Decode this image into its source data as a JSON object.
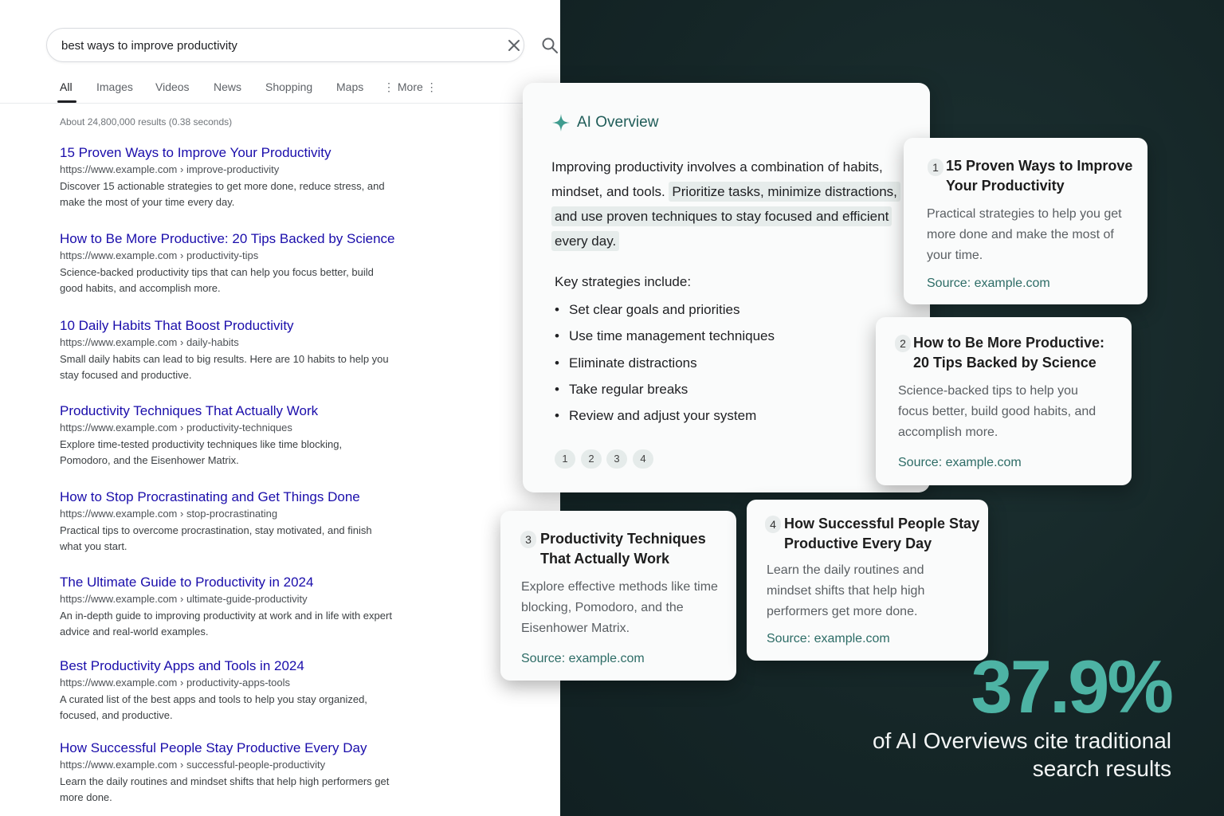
{
  "search": {
    "query": "best ways to improve productivity"
  },
  "tabs": [
    "All",
    "Images",
    "Videos",
    "News",
    "Shopping",
    "Maps",
    "⋮ More ⋮"
  ],
  "result_stats": "About 24,800,000 results (0.38 seconds)",
  "results": [
    {
      "title": "15 Proven Ways to Improve Your Productivity",
      "url": "https://www.example.com › improve-productivity",
      "snippet": "Discover 15 actionable strategies to get more done, reduce stress, and make the most of your time every day."
    },
    {
      "title": "How to Be More Productive: 20 Tips Backed by Science",
      "url": "https://www.example.com › productivity-tips",
      "snippet": "Science-backed productivity tips that can help you focus better, build good habits, and accomplish more."
    },
    {
      "title": "10 Daily Habits That Boost Productivity",
      "url": "https://www.example.com › daily-habits",
      "snippet": "Small daily habits can lead to big results. Here are 10 habits to help you stay focused and productive."
    },
    {
      "title": "Productivity Techniques That Actually Work",
      "url": "https://www.example.com › productivity-techniques",
      "snippet": "Explore time-tested productivity techniques like time blocking, Pomodoro, and the Eisenhower Matrix."
    },
    {
      "title": "How to Stop Procrastinating and Get Things Done",
      "url": "https://www.example.com › stop-procrastinating",
      "snippet": "Practical tips to overcome procrastination, stay motivated, and finish what you start."
    },
    {
      "title": "The Ultimate Guide to Productivity in 2024",
      "url": "https://www.example.com › ultimate-guide-productivity",
      "snippet": "An in-depth guide to improving productivity at work and in life with expert advice and real-world examples."
    },
    {
      "title": "Best Productivity Apps and Tools in 2024",
      "url": "https://www.example.com › productivity-apps-tools",
      "snippet": "A curated list of the best apps and tools to help you stay organized, focused, and productive."
    },
    {
      "title": "How Successful People Stay Productive Every Day",
      "url": "https://www.example.com › successful-people-productivity",
      "snippet": "Learn the daily routines and mindset shifts that help high performers get more done."
    }
  ],
  "ai_overview": {
    "title": "AI Overview",
    "intro": "Improving productivity involves a combination of habits, mindset, and tools. ",
    "highlight": "Prioritize tasks, minimize distractions, and use proven techniques to stay focused and efficient every day.",
    "key_title": "Key strategies include:",
    "strategies": [
      "Set clear goals and priorities",
      "Use time management techniques",
      "Eliminate distractions",
      "Take regular breaks",
      "Review and adjust your system"
    ],
    "citations": [
      "1",
      "2",
      "3",
      "4"
    ]
  },
  "source_cards": [
    {
      "num": "1",
      "title": "15 Proven Ways to Improve Your Productivity",
      "desc": "Practical strategies to help you get more done and make the most of your time.",
      "source": "Source: example.com"
    },
    {
      "num": "2",
      "title": "How to Be More Productive: 20 Tips Backed by Science",
      "desc": "Science-backed tips to help you focus better, build good habits, and accomplish more.",
      "source": "Source: example.com"
    },
    {
      "num": "3",
      "title": "Productivity Techniques That Actually Work",
      "desc": "Explore effective methods like time blocking, Pomodoro, and the Eisenhower Matrix.",
      "source": "Source: example.com"
    },
    {
      "num": "4",
      "title": "How Successful People Stay Productive Every Day",
      "desc": "Learn the daily routines and mindset shifts that help high performers get more done.",
      "source": "Source: example.com"
    }
  ],
  "stat": {
    "value": "37.9%",
    "caption": "of AI Overviews cite traditional search results"
  },
  "colors": {
    "link": "#1a0dab",
    "accent": "#4db3a4",
    "dark_bg": "#17292a",
    "ai_title": "#1f5c58"
  },
  "icons": [
    "close-icon",
    "search-icon",
    "sparkle-icon"
  ]
}
